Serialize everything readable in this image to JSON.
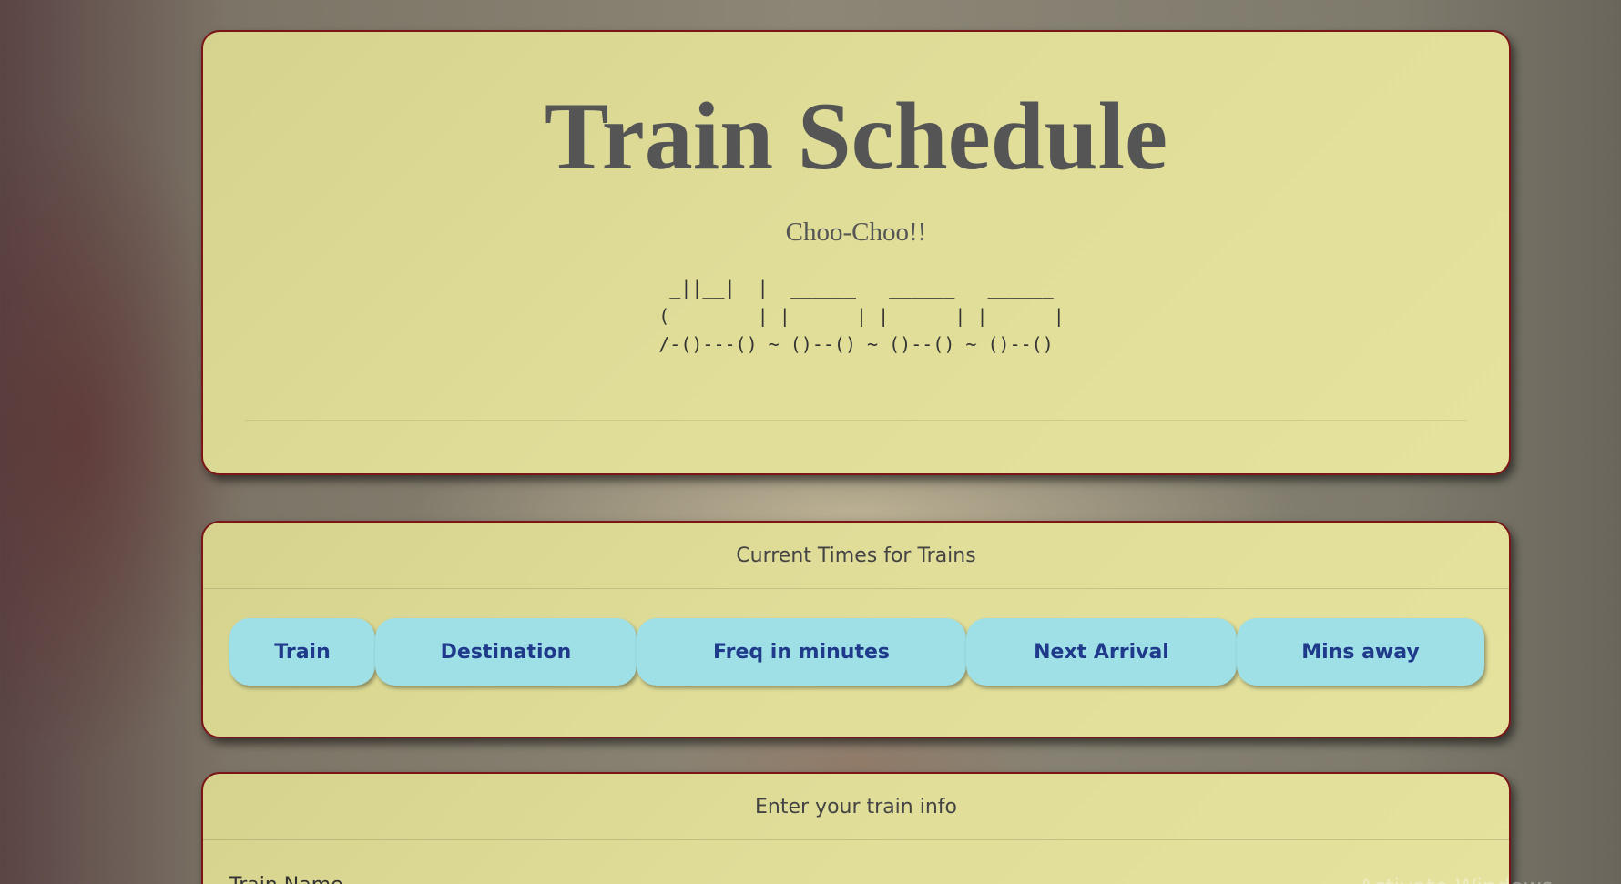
{
  "jumbotron": {
    "title": "Train Schedule",
    "subtitle": "Choo-Choo!!",
    "ascii_art": "  _||__|  |  ______   ______   ______\n (        | |      | |      | |      |\n /-()---() ~ ()--() ~ ()--() ~ ()--()"
  },
  "times_panel": {
    "heading": "Current Times for Trains",
    "columns": [
      "Train",
      "Destination",
      "Freq in minutes",
      "Next Arrival",
      "Mins away"
    ]
  },
  "info_panel": {
    "heading": "Enter your train info",
    "first_field_label": "Train Name"
  },
  "watermark": "Activate Windows",
  "colors": {
    "card_border": "#7a1518",
    "card_background": "#dfdd98",
    "header_cell": "#9ee0e6",
    "header_text": "#1f3a8a",
    "title_text": "#555555"
  }
}
